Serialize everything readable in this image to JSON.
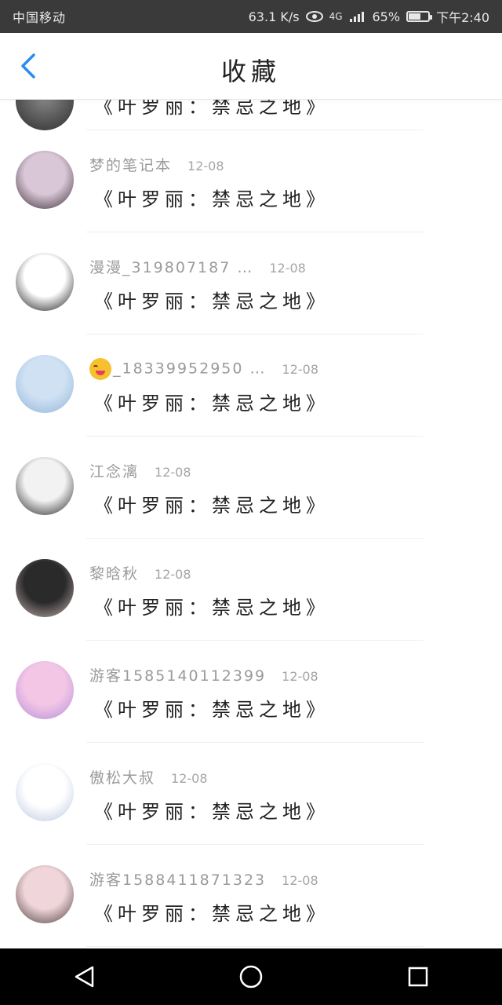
{
  "status_bar": {
    "carrier": "中国移动",
    "speed": "63.1 K/s",
    "network": "4G",
    "battery": "65%",
    "battery_level": 0.65,
    "time": "下午2:40"
  },
  "header": {
    "title": "收藏",
    "back_icon": "chevron-left-icon"
  },
  "list": {
    "top_partial": {
      "book": "《叶罗丽：禁忌之地》"
    },
    "items": [
      {
        "name": "梦的笔记本",
        "date": "12-08",
        "book": "《叶罗丽：禁忌之地》",
        "avatar_colors": [
          "#d9c7d7",
          "#3a2a35"
        ]
      },
      {
        "name": "漫漫_319807187 …",
        "date": "12-08",
        "book": "《叶罗丽：禁忌之地》",
        "avatar_colors": [
          "#ffffff",
          "#111111"
        ]
      },
      {
        "name": "_18339952950 …",
        "date": "12-08",
        "book": "《叶罗丽：禁忌之地》",
        "avatar_colors": [
          "#cfe1f3",
          "#8fb3d9"
        ],
        "has_emoji": true
      },
      {
        "name": "江念漓",
        "date": "12-08",
        "book": "《叶罗丽：禁忌之地》",
        "avatar_colors": [
          "#f2f2f2",
          "#1c1c1c"
        ]
      },
      {
        "name": "黎晗秋",
        "date": "12-08",
        "book": "《叶罗丽：禁忌之地》",
        "avatar_colors": [
          "#2a2a2a",
          "#c7b2b2"
        ]
      },
      {
        "name": "游客1585140112399",
        "date": "12-08",
        "book": "《叶罗丽：禁忌之地》",
        "avatar_colors": [
          "#f4c6e6",
          "#b28fd8"
        ]
      },
      {
        "name": "傲松大叔",
        "date": "12-08",
        "book": "《叶罗丽：禁忌之地》",
        "avatar_colors": [
          "#ffffff",
          "#b9c7e0"
        ]
      },
      {
        "name": "游客1588411871323",
        "date": "12-08",
        "book": "《叶罗丽：禁忌之地》",
        "avatar_colors": [
          "#f0d6da",
          "#4a3a3a"
        ]
      }
    ]
  },
  "nav": {
    "back": "triangle-back-icon",
    "home": "circle-home-icon",
    "recent": "square-recent-icon"
  }
}
